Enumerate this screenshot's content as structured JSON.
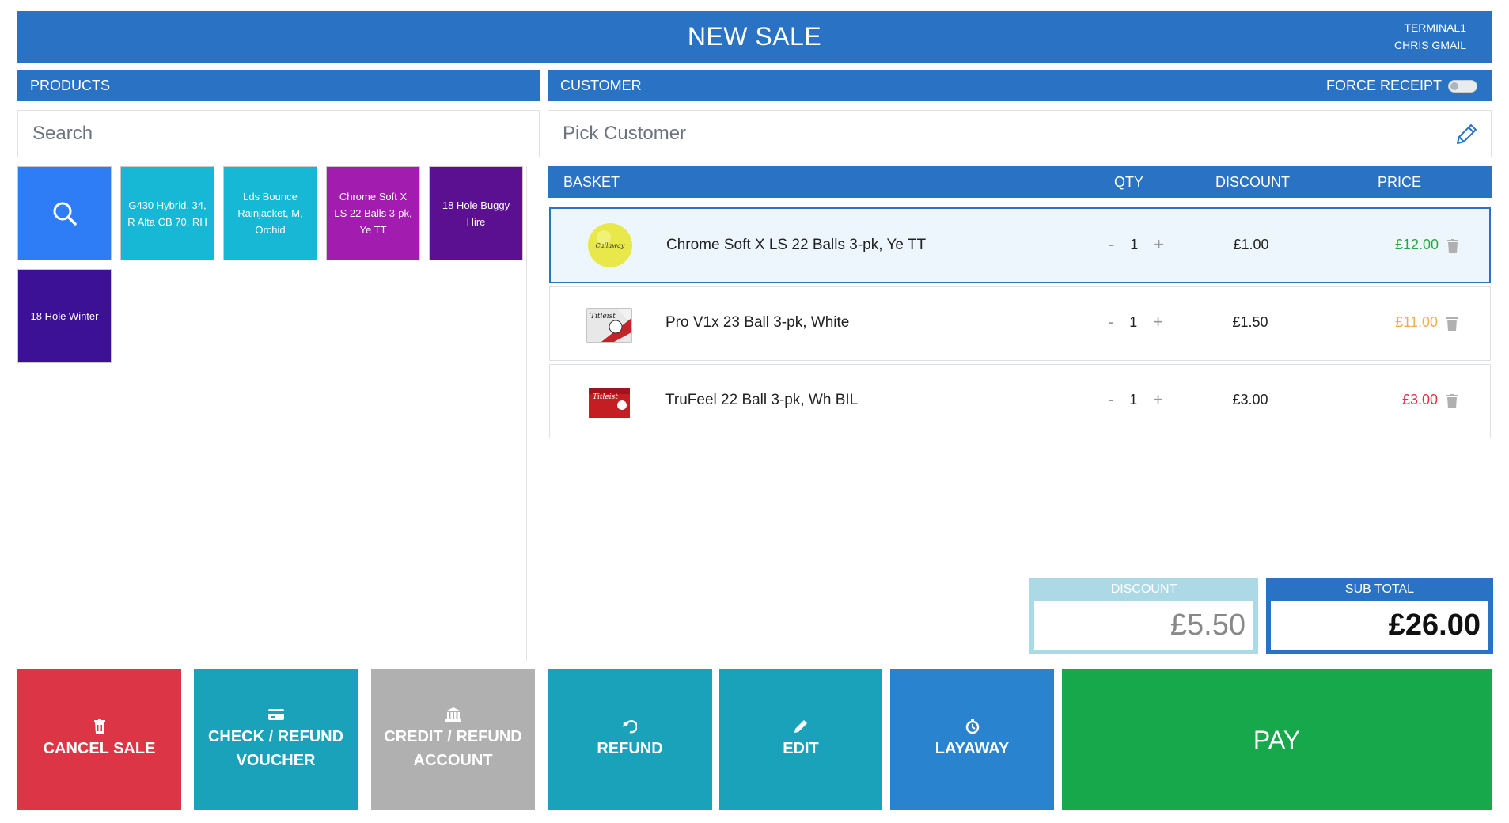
{
  "header": {
    "title": "NEW SALE",
    "terminal": "TERMINAL1",
    "user": "CHRIS GMAIL"
  },
  "products": {
    "heading": "PRODUCTS",
    "search_placeholder": "Search"
  },
  "customer": {
    "heading": "CUSTOMER",
    "force_receipt_label": "FORCE RECEIPT",
    "force_receipt_on": false,
    "picker_placeholder": "Pick Customer"
  },
  "tiles": [
    {
      "label": "",
      "icon": "search-icon",
      "color": "#2f7df6"
    },
    {
      "label": "G430 Hybrid, 34, R Alta CB 70, RH",
      "color": "#16b8d6"
    },
    {
      "label": "Lds Bounce Rainjacket, M, Orchid",
      "color": "#16b8d6"
    },
    {
      "label": "Chrome Soft X LS 22 Balls 3-pk, Ye TT",
      "color": "#a21caf"
    },
    {
      "label": "18 Hole Buggy Hire",
      "color": "#5b0f91"
    },
    {
      "label": "18 Hole Winter",
      "color": "#3c1196"
    }
  ],
  "basket": {
    "heading": "BASKET",
    "col_qty": "QTY",
    "col_discount": "DISCOUNT",
    "col_price": "PRICE",
    "items": [
      {
        "name": "Chrome Soft X LS 22 Balls 3-pk, Ye TT",
        "qty": "1",
        "discount": "£1.00",
        "price": "£12.00",
        "price_color": "#28a745",
        "thumb": "yellow-golf-ball-image",
        "selected": true
      },
      {
        "name": "Pro V1x 23 Ball 3-pk, White",
        "qty": "1",
        "discount": "£1.50",
        "price": "£11.00",
        "price_color": "#f0ad4e",
        "thumb": "titleist-pro-v1x-box-image",
        "selected": false
      },
      {
        "name": "TruFeel 22 Ball 3-pk, Wh BIL",
        "qty": "1",
        "discount": "£3.00",
        "price": "£3.00",
        "price_color": "#dc3545",
        "thumb": "titleist-trufeel-box-image",
        "selected": false
      }
    ],
    "minus": "-",
    "plus": "+"
  },
  "totals": {
    "discount_label": "DISCOUNT",
    "discount_value": "£5.50",
    "subtotal_label": "SUB TOTAL",
    "subtotal_value": "£26.00"
  },
  "actions": {
    "cancel_sale": {
      "label": "CANCEL SALE",
      "icon": "trash-icon",
      "color": "#dc3545"
    },
    "check_refund_voucher": {
      "line1": "CHECK / REFUND",
      "line2": "VOUCHER",
      "icon": "credit-card-icon",
      "color": "#1ba2bb"
    },
    "credit_refund_account": {
      "line1": "CREDIT / REFUND",
      "line2": "ACCOUNT",
      "icon": "bank-icon",
      "color": "#b0b0b0"
    },
    "refund": {
      "label": "REFUND",
      "icon": "undo-icon",
      "color": "#1ba2bb"
    },
    "edit": {
      "label": "EDIT",
      "icon": "pencil-icon",
      "color": "#1ba2bb"
    },
    "layaway": {
      "label": "LAYAWAY",
      "icon": "clock-icon",
      "color": "#2a83cf"
    },
    "pay": {
      "label": "PAY",
      "color": "#16a84a"
    }
  }
}
